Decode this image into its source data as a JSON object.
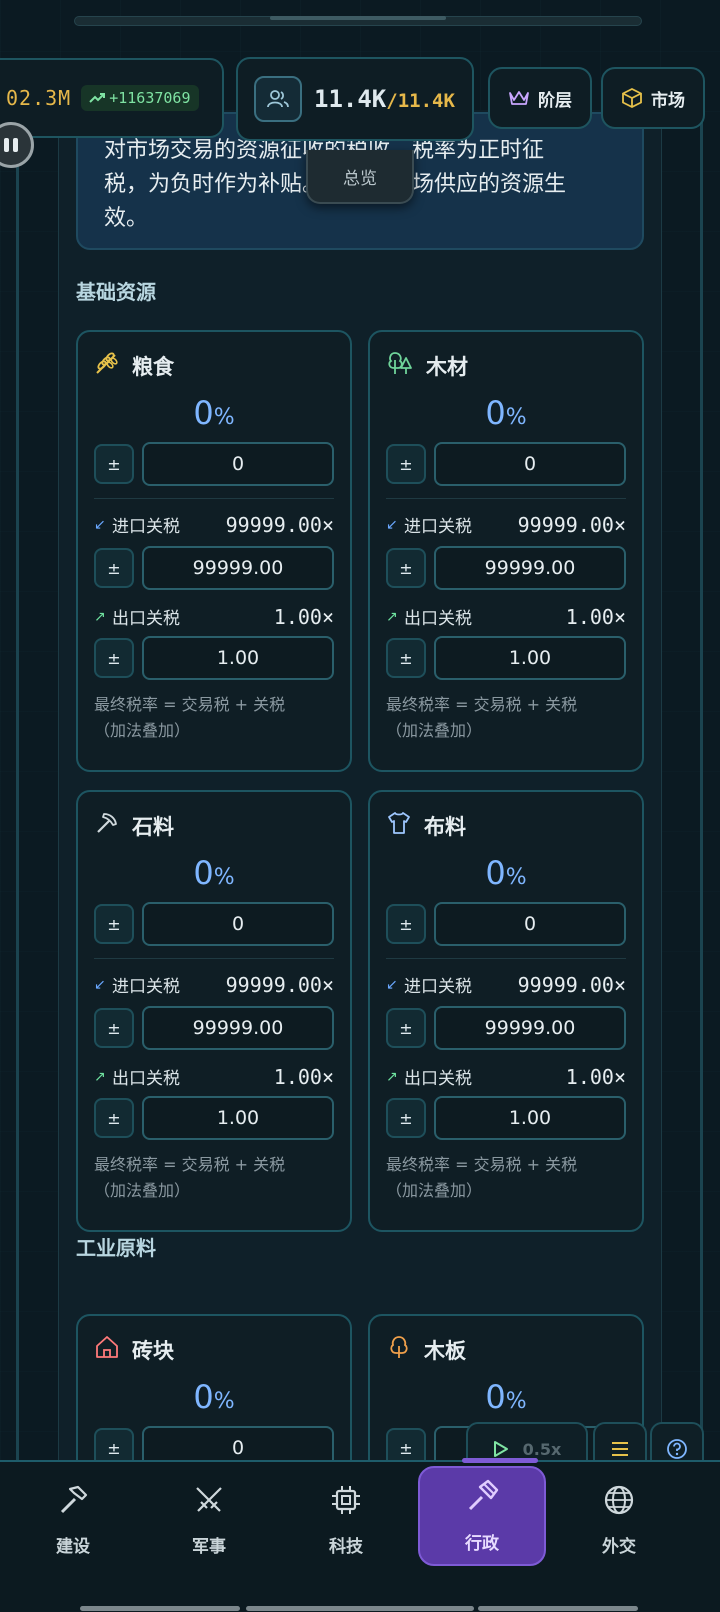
{
  "header": {
    "money": "02.3M",
    "money_delta": "+11637069",
    "population": "11.4K",
    "population_max": "/11.4K",
    "strata_label": "阶层",
    "market_label": "市场"
  },
  "overview_tab": "总览",
  "description": {
    "line1": "对市场交易的资源征收的税收，税率为正时征",
    "line2": "税，为负时作为补贴。仅对有市场供应的资源生",
    "line3": "效。"
  },
  "sections": {
    "basic": "基础资源",
    "industrial": "工业原料"
  },
  "labels": {
    "pm": "±",
    "import_tariff": "进口关税",
    "export_tariff": "出口关税",
    "note_line1": "最终税率 = 交易税 + 关税",
    "note_line2": "（加法叠加）",
    "pct_sign": "%"
  },
  "resources": [
    {
      "name": "粮食",
      "icon": "wheat-icon",
      "rate": "0",
      "tax_input": "0",
      "import_val": "99999.00×",
      "import_input": "99999.00",
      "export_val": "1.00×",
      "export_input": "1.00"
    },
    {
      "name": "木材",
      "icon": "tree-icon",
      "rate": "0",
      "tax_input": "0",
      "import_val": "99999.00×",
      "import_input": "99999.00",
      "export_val": "1.00×",
      "export_input": "1.00"
    },
    {
      "name": "石料",
      "icon": "pickaxe-icon",
      "rate": "0",
      "tax_input": "0",
      "import_val": "99999.00×",
      "import_input": "99999.00",
      "export_val": "1.00×",
      "export_input": "1.00"
    },
    {
      "name": "布料",
      "icon": "shirt-icon",
      "rate": "0",
      "tax_input": "0",
      "import_val": "99999.00×",
      "import_input": "99999.00",
      "export_val": "1.00×",
      "export_input": "1.00"
    },
    {
      "name": "砖块",
      "icon": "brick-house-icon",
      "rate": "0",
      "tax_input": "0"
    },
    {
      "name": "木板",
      "icon": "plank-tree-icon",
      "rate": "0",
      "tax_input": ""
    }
  ],
  "speed": {
    "value": "0.5x"
  },
  "nav": [
    {
      "label": "建设",
      "icon": "hammer-icon"
    },
    {
      "label": "军事",
      "icon": "swords-icon"
    },
    {
      "label": "科技",
      "icon": "chip-icon"
    },
    {
      "label": "行政",
      "icon": "gavel-icon"
    },
    {
      "label": "外交",
      "icon": "globe-icon"
    }
  ],
  "colors": {
    "accent": "#1d5561",
    "active_nav": "#5b3aa8",
    "gold": "#e6b84a",
    "rate_blue": "#7fb6ff"
  }
}
